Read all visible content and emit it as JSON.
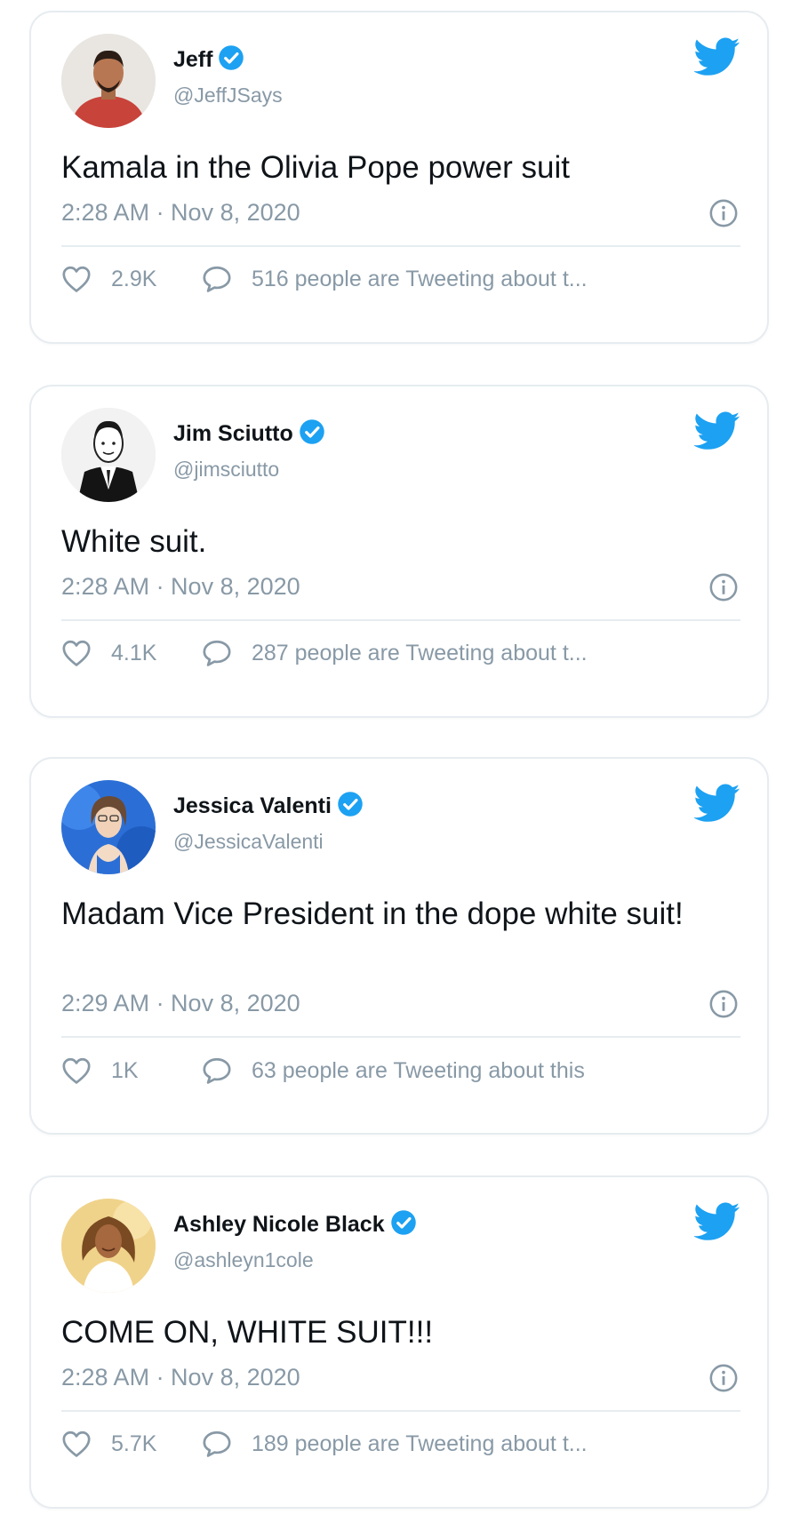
{
  "tweets": [
    {
      "name": "Jeff",
      "handle": "@JeffJSays",
      "text": "Kamala in the Olivia Pope power suit",
      "timestamp": "2:28 AM · Nov 8, 2020",
      "likes": "2.9K",
      "discussion": "516 people are Tweeting about t...",
      "verified": true
    },
    {
      "name": "Jim Sciutto",
      "handle": "@jimsciutto",
      "text": "White suit.",
      "timestamp": "2:28 AM · Nov 8, 2020",
      "likes": "4.1K",
      "discussion": "287 people are Tweeting about t...",
      "verified": true
    },
    {
      "name": "Jessica Valenti",
      "handle": "@JessicaValenti",
      "text": "Madam Vice President in the dope white suit!",
      "timestamp": "2:29 AM · Nov 8, 2020",
      "likes": "1K",
      "discussion": "63 people are Tweeting about this",
      "verified": true
    },
    {
      "name": "Ashley Nicole Black",
      "handle": "@ashleyn1cole",
      "text": "COME ON, WHITE SUIT!!!",
      "timestamp": "2:28 AM · Nov 8, 2020",
      "likes": "5.7K",
      "discussion": "189 people are Tweeting about t...",
      "verified": true
    }
  ],
  "icons": {
    "brand": "twitter-bird-icon",
    "verified": "verified-badge-icon",
    "info": "info-icon",
    "like": "heart-icon",
    "reply": "speech-bubble-icon"
  },
  "colors": {
    "twitter_blue": "#1da1f2",
    "text_primary": "#0f1419",
    "text_secondary": "#8899a6",
    "border": "#e6ecf0"
  }
}
